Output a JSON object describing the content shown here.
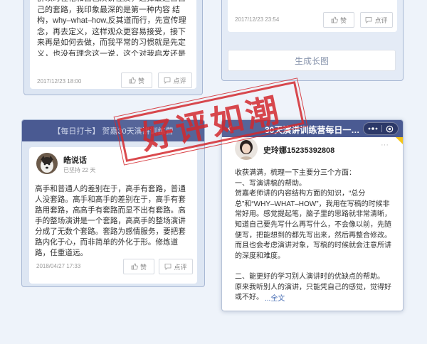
{
  "top_left_card": {
    "text": "群以时性格和自己演讲性质，选择最适合自己的套路，我印象最深的是第一种内容 结构，why–what–how,反其道而行，先宣传理念，再去定义，这样观众更容易接受，接下来再是如何去做，而我平常的习惯就是先定义，也没有理念这一说，这个对我启发还是很大的",
    "date": "2017/12/23 18:00",
    "like_label": "赞",
    "comment_label": "点评"
  },
  "top_right_card": {
    "date": "2017/12/23 23:54",
    "like_label": "赞",
    "comment_label": "点评"
  },
  "generate_button": "生成长图",
  "bottom_left": {
    "banner": "【每日打卡】 贺嘉30天演讲训练营",
    "user_name": "皓说话",
    "persist": "已坚持 22 天",
    "text": "高手和普通人的差别在于，高手有套路，普通人没套路。高手和高手的差别在于，高手有套路用套路，高高手有套路而显不出有套路。高手的整场演讲是一个套路，高高手的整场演讲分成了无数个套路。套路为感情服务，要把套路内化于心，而非简单的外化于形。修炼道路，任重道远。",
    "date": "2018/04/27 17:33",
    "like_label": "赞",
    "comment_label": "点评"
  },
  "phone": {
    "nav_title": "30天演讲训练营每日一…",
    "more_dots": "···",
    "user_name": "史玲娜15235392808",
    "text": "收获满满，梳理一下主要分三个方面：\n一、写演讲稿的帮助。\n贺嘉老师讲的内容结构方面的知识，“总分总”和“WHY–WHAT–HOW”，我用在写稿的时候非常好用。感觉提起笔，脑子里的思路就非常清晰，知道自己要先写什么再写什么，不会像以前，先随便写，把能想到的都先写出来，然后再整合修改。而且也会考虑演讲对象，写稿的时候就会注意所讲的深度和难度。\n\n二、能更好的学习别人演讲时的优缺点的帮助。\n原来我听别人的演讲，只能凭自己的感觉，觉得好或不好。",
    "expand": "...全文"
  },
  "stamp_text": "好评如潮",
  "colors": {
    "accent": "#4a5a92",
    "stamp": "#d42a2f",
    "link": "#4a6fb5",
    "background": "#eef3fa"
  },
  "icons": {
    "like": "thumb-up-icon",
    "comment": "comment-icon",
    "back": "chevron-left-icon",
    "menu": "more-icon",
    "close": "target-icon"
  }
}
